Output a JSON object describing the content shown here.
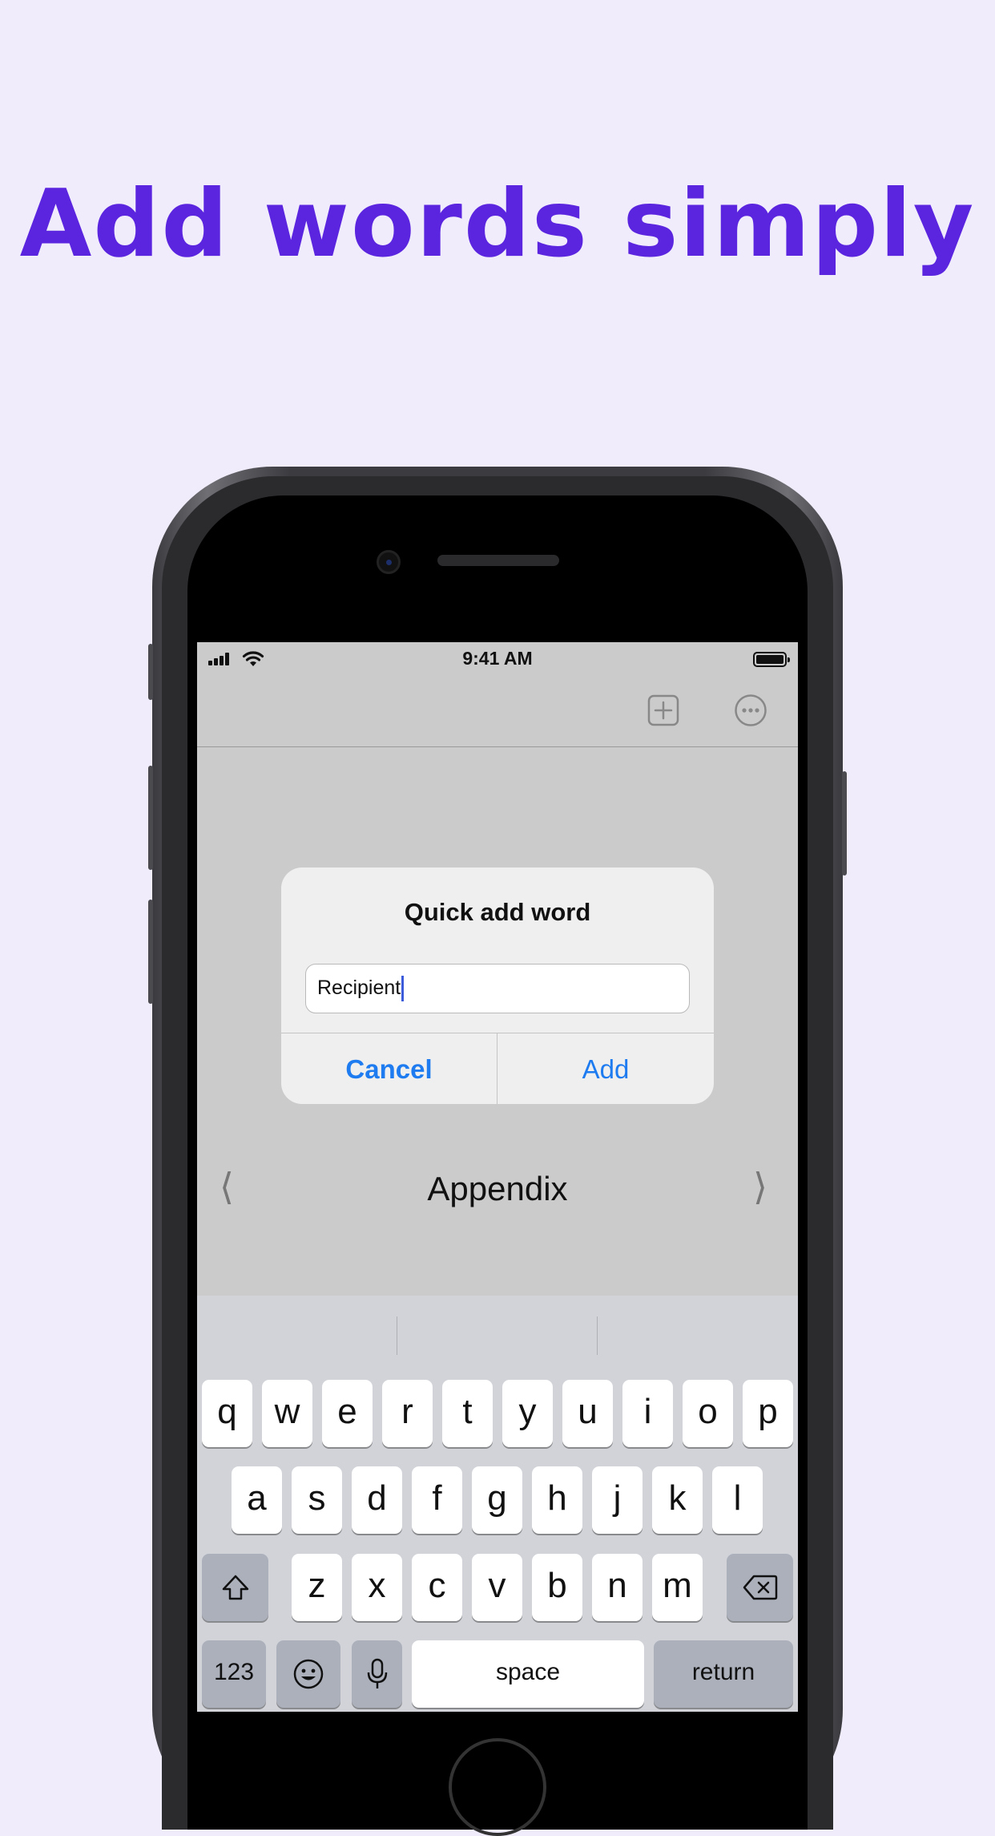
{
  "headline": "Add words simply",
  "status_bar": {
    "time": "9:41 AM"
  },
  "navbar": {
    "icons": [
      "add-square-icon",
      "more-ellipsis-icon"
    ]
  },
  "dialog": {
    "title": "Quick add word",
    "input_value": "Recipient",
    "cancel_label": "Cancel",
    "add_label": "Add"
  },
  "word_card": {
    "word": "Appendix",
    "prev_glyph": "⟨",
    "next_glyph": "⟩"
  },
  "keyboard": {
    "row1": [
      "q",
      "w",
      "e",
      "r",
      "t",
      "y",
      "u",
      "i",
      "o",
      "p"
    ],
    "row2": [
      "a",
      "s",
      "d",
      "f",
      "g",
      "h",
      "j",
      "k",
      "l"
    ],
    "row3": [
      "z",
      "x",
      "c",
      "v",
      "b",
      "n",
      "m"
    ],
    "numbers_label": "123",
    "space_label": "space",
    "return_label": "return"
  },
  "colors": {
    "accent": "#5b25e0",
    "link": "#1e7cf0",
    "background": "#f0ecfb"
  }
}
